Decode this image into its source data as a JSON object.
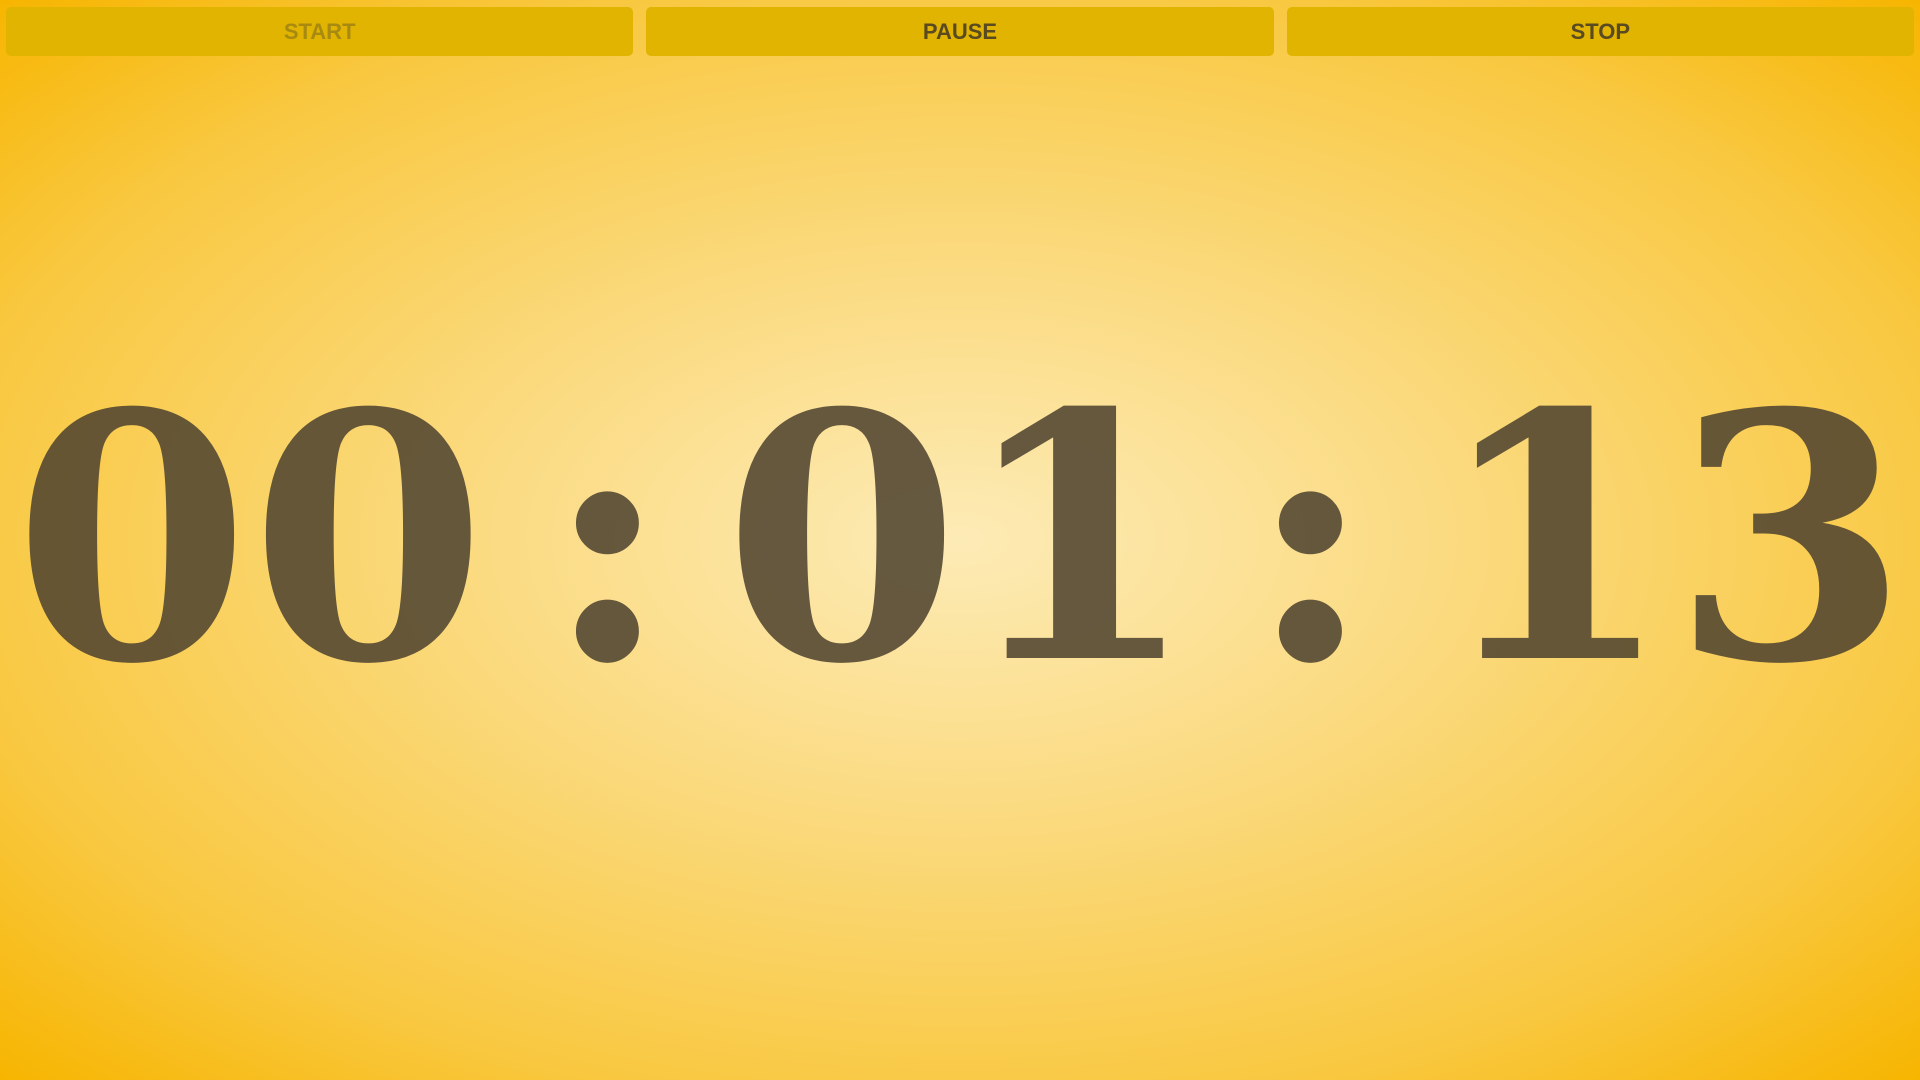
{
  "toolbar": {
    "start_label": "START",
    "pause_label": "PAUSE",
    "stop_label": "STOP"
  },
  "timer": {
    "hours": "00",
    "separator_1": ":",
    "minutes": "01",
    "separator_2": ":",
    "seconds": "13"
  },
  "colors": {
    "background_center": "#fdebb6",
    "background_edge": "#f7b500",
    "button_bg": "#e0b400",
    "button_text": "#5a4a20",
    "button_text_disabled": "#a88a10",
    "digits": "#504430"
  }
}
